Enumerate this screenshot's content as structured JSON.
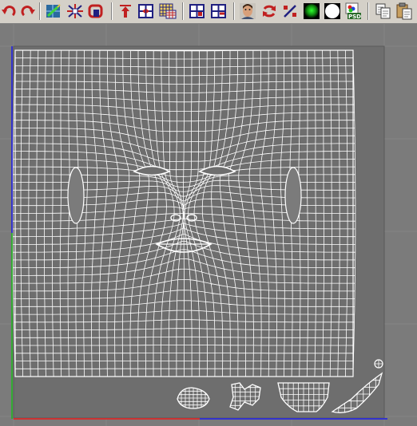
{
  "toolbar": {
    "buttons": [
      {
        "id": "undo",
        "icon": "undo-icon"
      },
      {
        "id": "redo",
        "icon": "redo-icon"
      },
      {
        "id": "edit-uvws",
        "icon": "edit-uvw-icon"
      },
      {
        "id": "weld",
        "icon": "weld-icon"
      },
      {
        "id": "break",
        "icon": "break-icon"
      },
      {
        "id": "move",
        "icon": "move-up-icon"
      },
      {
        "id": "center",
        "icon": "center-icon"
      },
      {
        "id": "checker",
        "icon": "checker-map-icon"
      },
      {
        "id": "select-vertex",
        "icon": "select-vertex-icon"
      },
      {
        "id": "select-edge",
        "icon": "select-edge-icon"
      },
      {
        "id": "face-preview",
        "icon": "face-render-icon"
      },
      {
        "id": "rotate",
        "icon": "rotate-icon"
      },
      {
        "id": "scale",
        "icon": "percent-scale-icon"
      },
      {
        "id": "color-channel",
        "icon": "color-channel-icon"
      },
      {
        "id": "alpha-channel",
        "icon": "alpha-channel-icon"
      },
      {
        "id": "export-psd",
        "icon": "psd-export-icon"
      },
      {
        "id": "copy",
        "icon": "copy-icon"
      },
      {
        "id": "paste",
        "icon": "paste-icon"
      }
    ]
  },
  "colors": {
    "toolbar_bg": "#d4d0c8",
    "viewport_bg": "#7b7b7b",
    "uv_square_bg": "#6e6e6e",
    "wire": "#ffffff",
    "axis_u": "#cc3333",
    "axis_v": "#3333cc",
    "axis_v_green": "#33aa33"
  }
}
